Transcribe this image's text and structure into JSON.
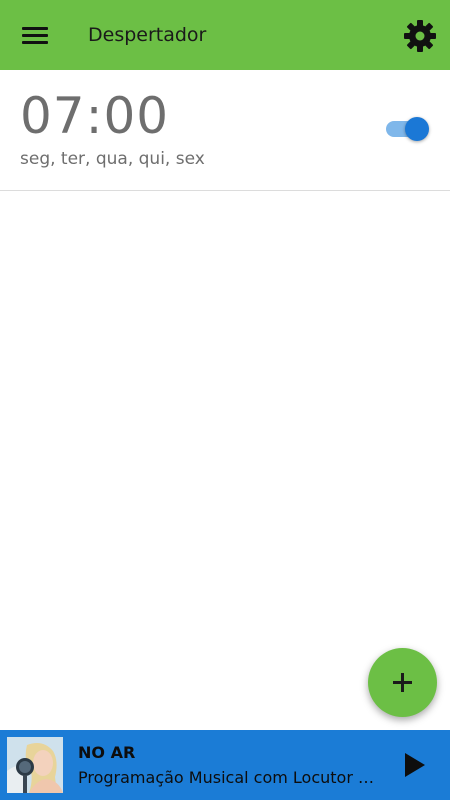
{
  "app": {
    "title": "Despertador",
    "accent_color": "#6cbf45",
    "player_color": "#1b7cd6"
  },
  "header": {
    "menu_icon": "hamburger-menu-icon",
    "settings_icon": "gear-icon"
  },
  "alarms": [
    {
      "time": "07:00",
      "days": "seg, ter, qua, qui, sex",
      "enabled": true
    }
  ],
  "fab": {
    "icon": "plus-icon"
  },
  "player": {
    "status": "NO AR",
    "program": "Programação Musical com Locutor Virtual",
    "thumbnail": "station-thumbnail",
    "play_icon": "play-icon"
  }
}
